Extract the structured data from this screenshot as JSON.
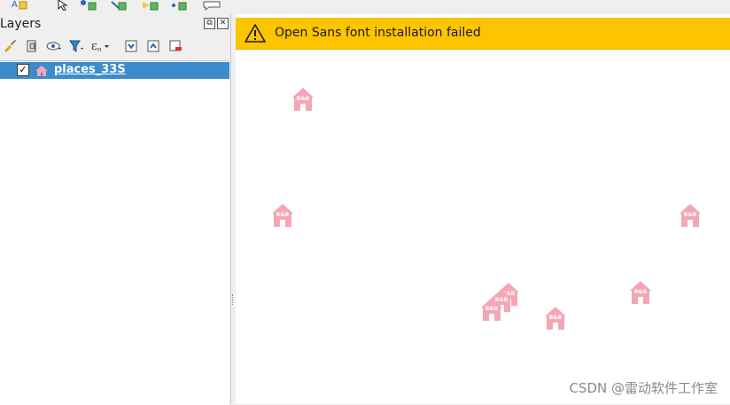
{
  "layers_panel": {
    "title": "Layers",
    "float_button": "⧉",
    "close_button": "✕",
    "layer": {
      "name": "places_33S",
      "checked": "✓",
      "icon": "house-icon"
    }
  },
  "message_bar": {
    "icon": "warning-icon",
    "text": "Open Sans font installation failed"
  },
  "map": {
    "marker_label": "B&B",
    "marker_color": "#f4a6b4"
  },
  "colors": {
    "message_bg": "#fdc400",
    "selected_row": "#3a8ccd"
  },
  "watermark": "CSDN @雷动软件工作室"
}
